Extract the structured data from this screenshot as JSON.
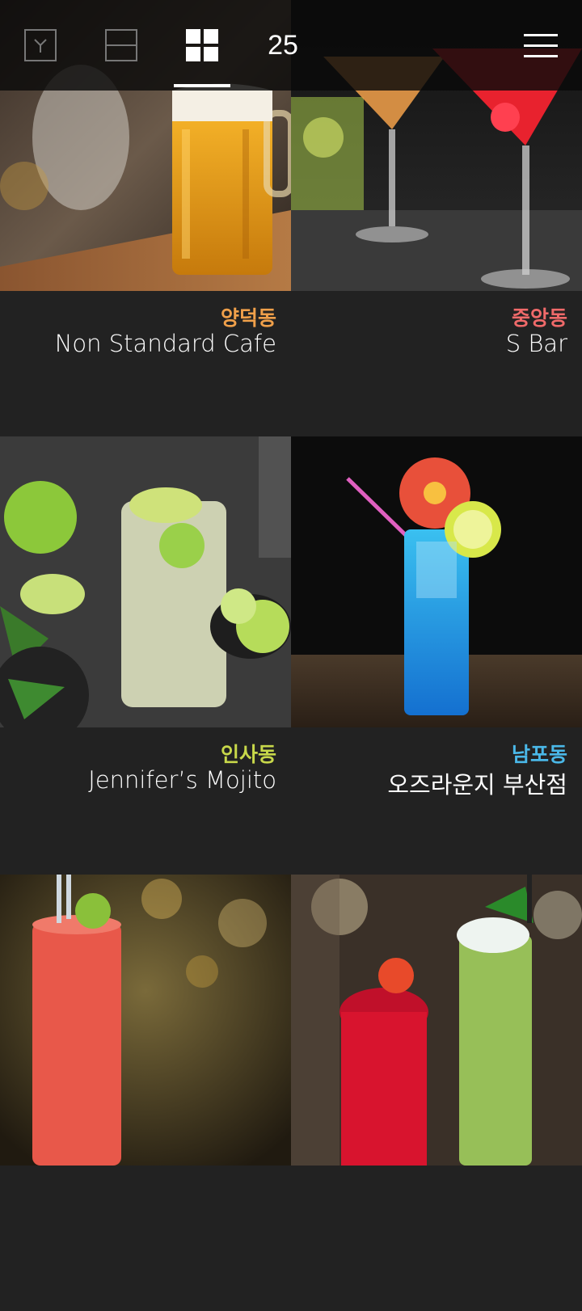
{
  "header": {
    "count": "25",
    "views": [
      {
        "icon": "cocktail-glass-icon"
      },
      {
        "icon": "list-view-icon"
      },
      {
        "icon": "grid-view-icon",
        "active": true
      }
    ],
    "menu_icon": "hamburger-menu-icon"
  },
  "cards": [
    {
      "district": "양덕동",
      "district_color": "#f0a04a",
      "venue": "Non Standard Cafe"
    },
    {
      "district": "중앙동",
      "district_color": "#f06a6a",
      "venue": "S Bar"
    },
    {
      "district": "인사동",
      "district_color": "#c8d84a",
      "venue": "Jennifer’s Mojito"
    },
    {
      "district": "남포동",
      "district_color": "#4ab8e8",
      "venue": "오즈라운지 부산점"
    },
    {
      "district": "",
      "district_color": "#ffffff",
      "venue": ""
    },
    {
      "district": "",
      "district_color": "#ffffff",
      "venue": ""
    }
  ]
}
